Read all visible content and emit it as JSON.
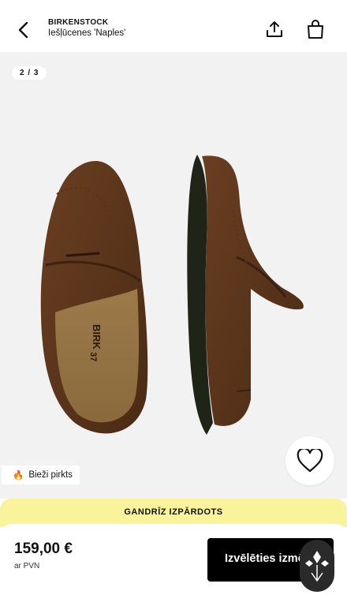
{
  "header": {
    "brand": "BIRKENSTOCK",
    "product": "Iešļūcenes 'Naples'",
    "icons": {
      "back": "chevron-left-icon",
      "share": "share-icon",
      "bag": "shopping-bag-icon"
    }
  },
  "gallery": {
    "counter": "2 / 3",
    "badge": {
      "icon": "fire-icon",
      "emoji": "🔥",
      "label": "Bieži pirkts"
    },
    "favorite_icon": "heart-icon"
  },
  "banner": {
    "text": "GANDRĪZ IZPĀRDOTS"
  },
  "purchase": {
    "price": "159,00 €",
    "vat": "ar PVN",
    "select_label": "Izvēlēties izmēru"
  },
  "colors": {
    "banner": "#f9f39c",
    "button": "#000000",
    "gallery_bg": "#f2f2f3"
  }
}
